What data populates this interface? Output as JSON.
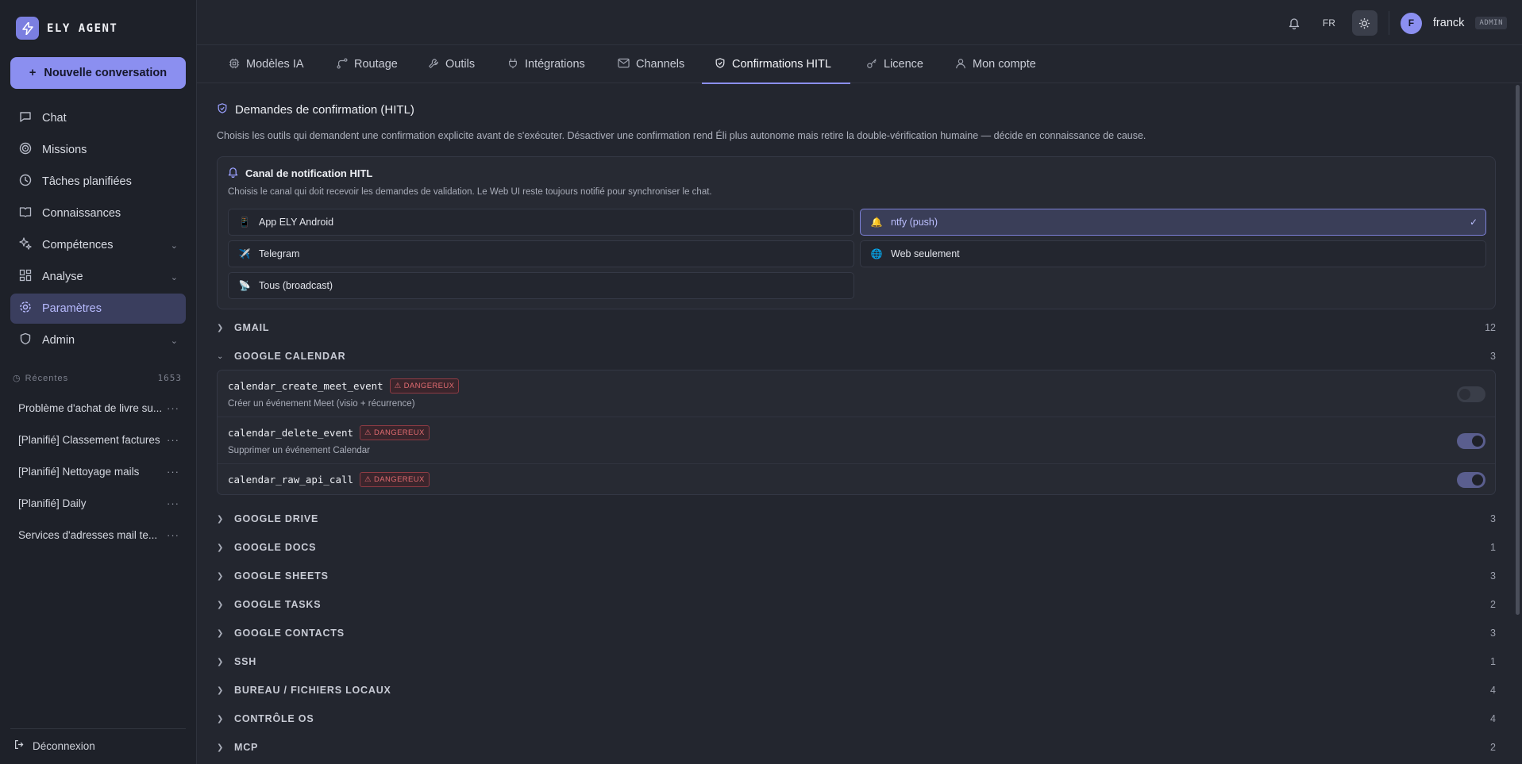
{
  "sidebar": {
    "brand": "ELY AGENT",
    "new_conversation": "Nouvelle conversation",
    "items": [
      {
        "label": "Chat",
        "icon": "chat-icon"
      },
      {
        "label": "Missions",
        "icon": "target-icon"
      },
      {
        "label": "Tâches planifiées",
        "icon": "clock-icon"
      },
      {
        "label": "Connaissances",
        "icon": "book-icon"
      },
      {
        "label": "Compétences",
        "icon": "sparkle-icon"
      },
      {
        "label": "Analyse",
        "icon": "grid-icon"
      },
      {
        "label": "Paramètres",
        "icon": "gear-icon",
        "active": true
      },
      {
        "label": "Admin",
        "icon": "shield-icon"
      }
    ],
    "recent_label": "Récentes",
    "recent_count": "1653",
    "recent": [
      "Problème d'achat de livre su...",
      "[Planifié] Classement factures",
      "[Planifié] Nettoyage mails",
      "[Planifié] Daily",
      "Services d'adresses mail te..."
    ],
    "recent_more": "···",
    "logout": "Déconnexion"
  },
  "topbar": {
    "lang": "FR",
    "avatar_initial": "F",
    "username": "franck",
    "role": "ADMIN"
  },
  "tabs": [
    {
      "label": "Modèles IA",
      "icon": "cpu-icon"
    },
    {
      "label": "Routage",
      "icon": "route-icon"
    },
    {
      "label": "Outils",
      "icon": "wrench-icon"
    },
    {
      "label": "Intégrations",
      "icon": "plug-icon"
    },
    {
      "label": "Channels",
      "icon": "mail-icon"
    },
    {
      "label": "Confirmations HITL",
      "icon": "shield-check-icon",
      "active": true
    },
    {
      "label": "Licence",
      "icon": "key-icon"
    },
    {
      "label": "Mon compte",
      "icon": "user-icon"
    }
  ],
  "main": {
    "title": "Demandes de confirmation (HITL)",
    "description": "Choisis les outils qui demandent une confirmation explicite avant de s'exécuter. Désactiver une confirmation rend Éli plus autonome mais retire la double-vérification humaine — décide en connaissance de cause.",
    "notif": {
      "title": "Canal de notification HITL",
      "description": "Choisis le canal qui doit recevoir les demandes de validation. Le Web UI reste toujours notifié pour synchroniser le chat.",
      "options": [
        {
          "label": "App ELY Android",
          "emoji": "📱"
        },
        {
          "label": "ntfy (push)",
          "emoji": "🔔",
          "selected": true
        },
        {
          "label": "Telegram",
          "emoji": "✈️"
        },
        {
          "label": "Web seulement",
          "emoji": "🌐"
        },
        {
          "label": "Tous (broadcast)",
          "emoji": "📡"
        }
      ],
      "check": "✓"
    },
    "groups_before": [
      {
        "name": "GMAIL",
        "count": "12"
      },
      {
        "name": "GOOGLE CALENDAR",
        "count": "3",
        "expanded": true
      }
    ],
    "calendar_tools": [
      {
        "name": "calendar_create_meet_event",
        "badge": "DANGEREUX",
        "desc": "Créer un événement Meet (visio + récurrence)",
        "enabled": false
      },
      {
        "name": "calendar_delete_event",
        "badge": "DANGEREUX",
        "desc": "Supprimer un événement Calendar",
        "enabled": true
      },
      {
        "name": "calendar_raw_api_call",
        "badge": "DANGEREUX",
        "desc": "",
        "enabled": true
      }
    ],
    "groups_after": [
      {
        "name": "GOOGLE DRIVE",
        "count": "3"
      },
      {
        "name": "GOOGLE DOCS",
        "count": "1"
      },
      {
        "name": "GOOGLE SHEETS",
        "count": "3"
      },
      {
        "name": "GOOGLE TASKS",
        "count": "2"
      },
      {
        "name": "GOOGLE CONTACTS",
        "count": "3"
      },
      {
        "name": "SSH",
        "count": "1"
      },
      {
        "name": "BUREAU / FICHIERS LOCAUX",
        "count": "4"
      },
      {
        "name": "CONTRÔLE OS",
        "count": "4"
      },
      {
        "name": "MCP",
        "count": "2"
      }
    ]
  },
  "colors": {
    "accent": "#8b8ff0",
    "danger": "#e06b70",
    "background": "#23262f"
  }
}
